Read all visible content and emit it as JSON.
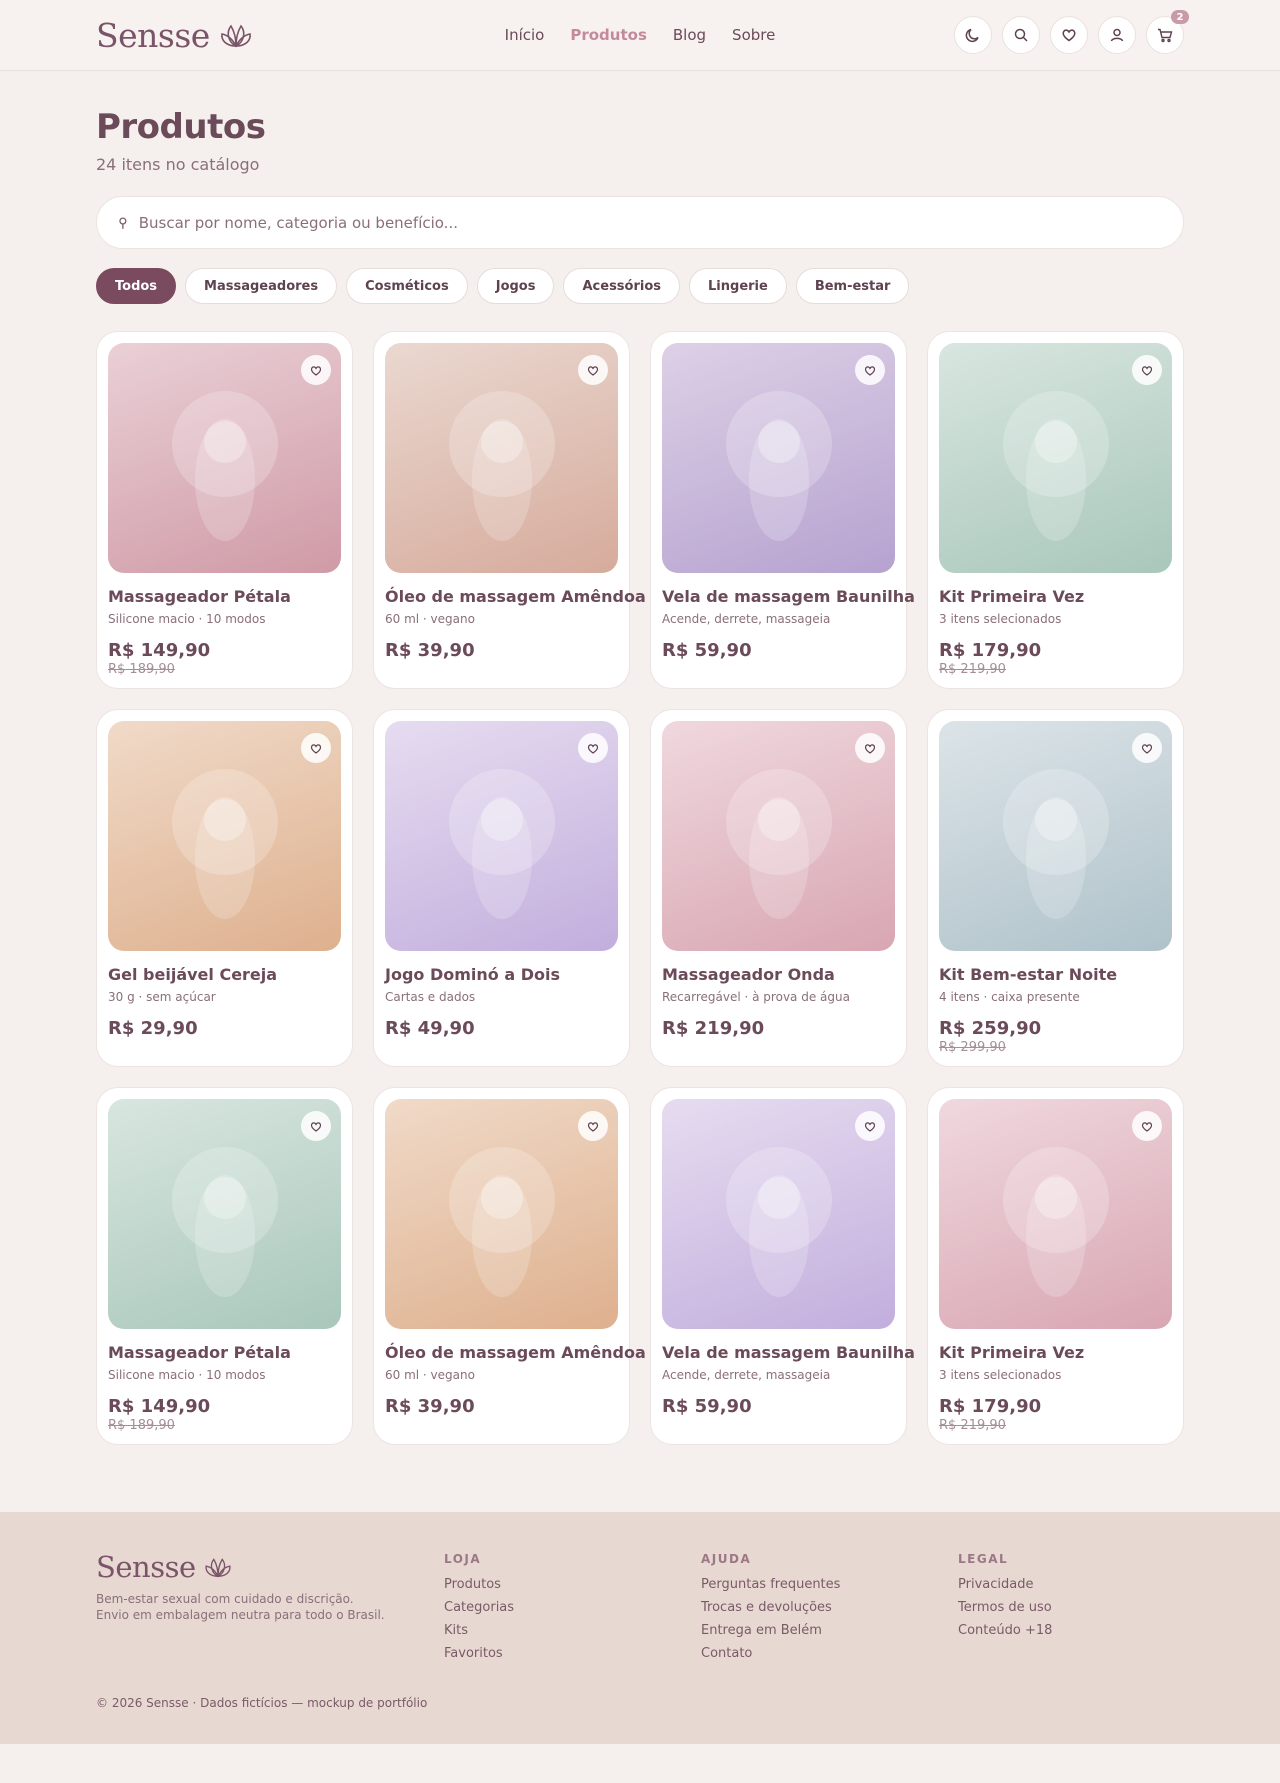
{
  "brand": {
    "name": "Sensse"
  },
  "nav": [
    {
      "label": "Início",
      "active": false
    },
    {
      "label": "Produtos",
      "active": true
    },
    {
      "label": "Blog",
      "active": false
    },
    {
      "label": "Sobre",
      "active": false
    }
  ],
  "header_actions": {
    "theme_icon": "moon-icon",
    "search_icon": "search-icon",
    "favorites_icon": "heart-icon",
    "account_icon": "user-icon",
    "cart_icon": "cart-icon",
    "cart_count": "2"
  },
  "page": {
    "title": "Produtos",
    "subtitle": "24 itens no catálogo"
  },
  "search": {
    "placeholder": "Buscar por nome, categoria ou benefício...",
    "value": ""
  },
  "filters": [
    {
      "label": "Todos",
      "active": true
    },
    {
      "label": "Massageadores",
      "active": false
    },
    {
      "label": "Cosméticos",
      "active": false
    },
    {
      "label": "Jogos",
      "active": false
    },
    {
      "label": "Acessórios",
      "active": false
    },
    {
      "label": "Lingerie",
      "active": false
    },
    {
      "label": "Bem-estar",
      "active": false
    }
  ],
  "products": [
    {
      "name": "Massageador Pétala",
      "desc": "Silicone macio · 10 modos",
      "price": "R$ 149,90",
      "old_price": "R$ 189,90",
      "colors": [
        "#ead0d6",
        "#cf9aa6"
      ]
    },
    {
      "name": "Óleo de massagem Amêndoa",
      "desc": "60 ml · vegano",
      "price": "R$ 39,90",
      "old_price": "",
      "colors": [
        "#ead8d0",
        "#d6ab9c"
      ]
    },
    {
      "name": "Vela de massagem Baunilha",
      "desc": "Acende, derrete, massageia",
      "price": "R$ 59,90",
      "old_price": "",
      "colors": [
        "#ddd0e6",
        "#b6a2d0"
      ]
    },
    {
      "name": "Kit Primeira Vez",
      "desc": "3 itens selecionados",
      "price": "R$ 179,90",
      "old_price": "R$ 219,90",
      "colors": [
        "#d8e6e0",
        "#a9c7bb"
      ]
    },
    {
      "name": "Gel beijável Cereja",
      "desc": "30 g · sem açúcar",
      "price": "R$ 29,90",
      "old_price": "",
      "colors": [
        "#f0dac8",
        "#deb08e"
      ]
    },
    {
      "name": "Jogo Dominó a Dois",
      "desc": "Cartas e dados",
      "price": "R$ 49,90",
      "old_price": "",
      "colors": [
        "#e6dcf0",
        "#c2aedd"
      ]
    },
    {
      "name": "Massageador Onda",
      "desc": "Recarregável · à prova de água",
      "price": "R$ 219,90",
      "old_price": "",
      "colors": [
        "#f0d8de",
        "#d8a6b2"
      ]
    },
    {
      "name": "Kit Bem-estar Noite",
      "desc": "4 itens · caixa presente",
      "price": "R$ 259,90",
      "old_price": "R$ 299,90",
      "colors": [
        "#dce4e8",
        "#afc2ca"
      ]
    },
    {
      "name": "Massageador Pétala",
      "desc": "Silicone macio · 10 modos",
      "price": "R$ 149,90",
      "old_price": "R$ 189,90",
      "colors": [
        "#d8e6e0",
        "#a9c7bb"
      ]
    },
    {
      "name": "Óleo de massagem Amêndoa",
      "desc": "60 ml · vegano",
      "price": "R$ 39,90",
      "old_price": "",
      "colors": [
        "#f0dac8",
        "#deb08e"
      ]
    },
    {
      "name": "Vela de massagem Baunilha",
      "desc": "Acende, derrete, massageia",
      "price": "R$ 59,90",
      "old_price": "",
      "colors": [
        "#e6dcf0",
        "#c2aedd"
      ]
    },
    {
      "name": "Kit Primeira Vez",
      "desc": "3 itens selecionados",
      "price": "R$ 179,90",
      "old_price": "R$ 219,90",
      "colors": [
        "#f0d8de",
        "#d8a6b2"
      ]
    }
  ],
  "footer": {
    "tagline": "Bem-estar sexual com cuidado e discrição. Envio em embalagem neutra para todo o Brasil.",
    "columns": [
      {
        "title": "LOJA",
        "links": [
          "Produtos",
          "Categorias",
          "Kits",
          "Favoritos"
        ]
      },
      {
        "title": "AJUDA",
        "links": [
          "Perguntas frequentes",
          "Trocas e devoluções",
          "Entrega em Belém",
          "Contato"
        ]
      },
      {
        "title": "LEGAL",
        "links": [
          "Privacidade",
          "Termos de uso",
          "Conteúdo +18"
        ]
      }
    ],
    "copyright": "© 2026 Sensse · Dados fictícios — mockup de portfólio"
  },
  "colors": {
    "background": "#f5f0ed",
    "accent": "#7a4a5f",
    "nav_active": "#c48a9b",
    "footer_bg": "#e8d8d2"
  }
}
